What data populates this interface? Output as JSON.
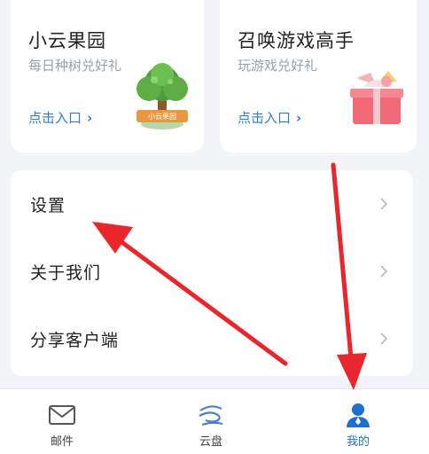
{
  "promos": [
    {
      "title": "小云果园",
      "desc": "每日种树兑好礼",
      "link": "点击入口",
      "art_badge": "小云果园",
      "icon": "tree-icon"
    },
    {
      "title": "召唤游戏高手",
      "desc": "玩游戏兑好礼",
      "link": "点击入口",
      "icon": "gift-box-icon"
    }
  ],
  "settings": {
    "items": [
      {
        "label": "设置",
        "icon": "chevron-right-icon"
      },
      {
        "label": "关于我们",
        "icon": "chevron-right-icon"
      },
      {
        "label": "分享客户端",
        "icon": "chevron-right-icon"
      }
    ]
  },
  "nav": {
    "items": [
      {
        "label": "邮件",
        "icon": "mail-icon",
        "active": false
      },
      {
        "label": "云盘",
        "icon": "cloud-icon",
        "active": false
      },
      {
        "label": "我的",
        "icon": "user-icon",
        "active": true
      }
    ]
  },
  "colors": {
    "accent": "#2e7bd6",
    "nav_active": "#1f6fd1",
    "arrow": "#e8262c",
    "background": "#f2f4f7"
  }
}
